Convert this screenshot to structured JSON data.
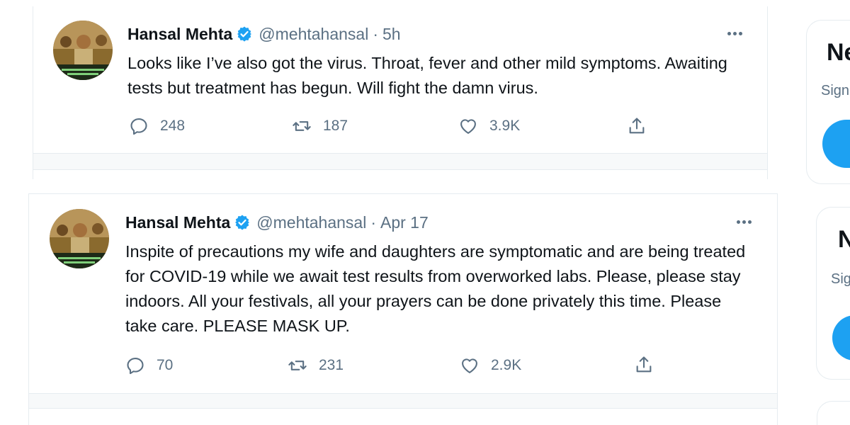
{
  "tweets": [
    {
      "name": "Hansal Mehta",
      "handle": "@mehtahansal",
      "separator": "·",
      "time": "5h",
      "text": "Looks like I’ve also got the virus. Throat, fever and other mild symptoms. Awaiting tests but treatment has begun. Will fight the damn virus.",
      "replies": "248",
      "retweets": "187",
      "likes": "3.9K",
      "icons": [
        "avatar",
        "verified-badge-icon",
        "more-options-icon",
        "reply-icon",
        "retweet-icon",
        "like-icon",
        "share-icon"
      ]
    },
    {
      "name": "Hansal Mehta",
      "handle": "@mehtahansal",
      "separator": "·",
      "time": "Apr 17",
      "text": "Inspite of precautions my wife and daughters are symptomatic and are being treated for COVID-19 while we await test results from overworked labs. Please, please stay indoors. All your festivals, all your prayers can be done privately this time. Please take care. PLEASE MASK UP.",
      "replies": "70",
      "retweets": "231",
      "likes": "2.9K",
      "icons": [
        "avatar",
        "verified-badge-icon",
        "more-options-icon",
        "reply-icon",
        "retweet-icon",
        "like-icon",
        "share-icon"
      ]
    }
  ],
  "sidebar": [
    {
      "title_fragment": "Ne",
      "subtitle_fragment": "Sign"
    },
    {
      "title_fragment": "N",
      "subtitle_fragment": "Sig"
    }
  ],
  "colors": {
    "accent": "#1da1f2",
    "text": "#0f1419",
    "muted": "#5b7083",
    "border": "#e6ecf0",
    "divider": "#f7f9fa"
  }
}
